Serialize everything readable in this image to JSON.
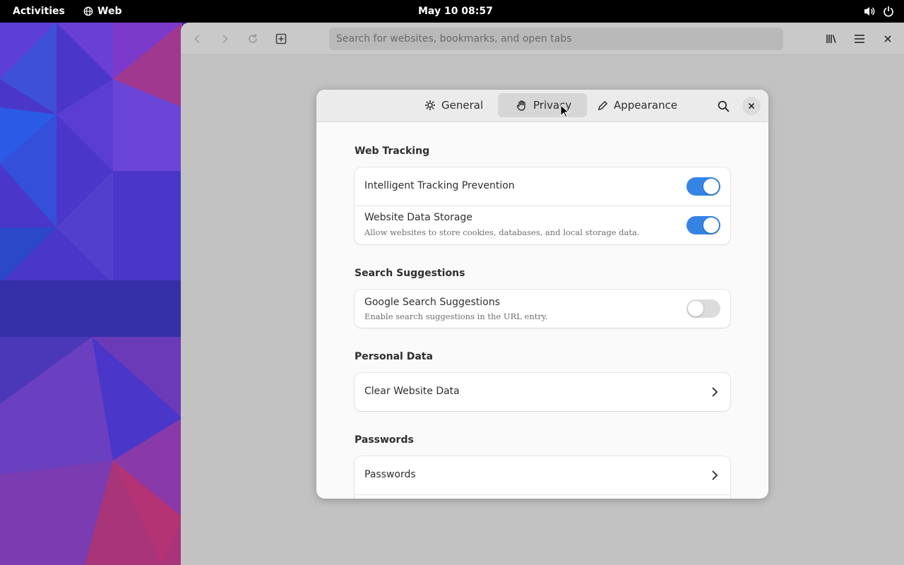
{
  "topbar": {
    "activities": "Activities",
    "app_name": "Web",
    "clock": "May 10  08:57",
    "icons": [
      "globe-icon",
      "volume-icon",
      "power-icon"
    ]
  },
  "browser": {
    "url_placeholder": "Search for websites, bookmarks, and open tabs",
    "icons": [
      "back-icon",
      "forward-icon",
      "reload-icon",
      "new-tab-icon",
      "library-icon",
      "menu-icon",
      "close-icon"
    ]
  },
  "dialog": {
    "tabs": [
      {
        "label": "General",
        "icon": "gear-icon"
      },
      {
        "label": "Privacy",
        "icon": "hand-icon",
        "active": true
      },
      {
        "label": "Appearance",
        "icon": "pencil-icon"
      }
    ],
    "sections": {
      "web_tracking": {
        "title": "Web Tracking",
        "rows": [
          {
            "title": "Intelligent Tracking Prevention",
            "switch": "on"
          },
          {
            "title": "Website Data Storage",
            "subtitle": "Allow websites to store cookies, databases, and local storage data.",
            "switch": "on"
          }
        ]
      },
      "search_suggestions": {
        "title": "Search Suggestions",
        "rows": [
          {
            "title": "Google Search Suggestions",
            "subtitle": "Enable search suggestions in the URL entry.",
            "switch": "off"
          }
        ]
      },
      "personal_data": {
        "title": "Personal Data",
        "rows": [
          {
            "title": "Clear Website Data"
          }
        ]
      },
      "passwords": {
        "title": "Passwords",
        "rows": [
          {
            "title": "Passwords"
          }
        ]
      }
    }
  },
  "colors": {
    "accent": "#3584e4",
    "topbar": "#000000",
    "dialog_bg": "#fafafa"
  }
}
